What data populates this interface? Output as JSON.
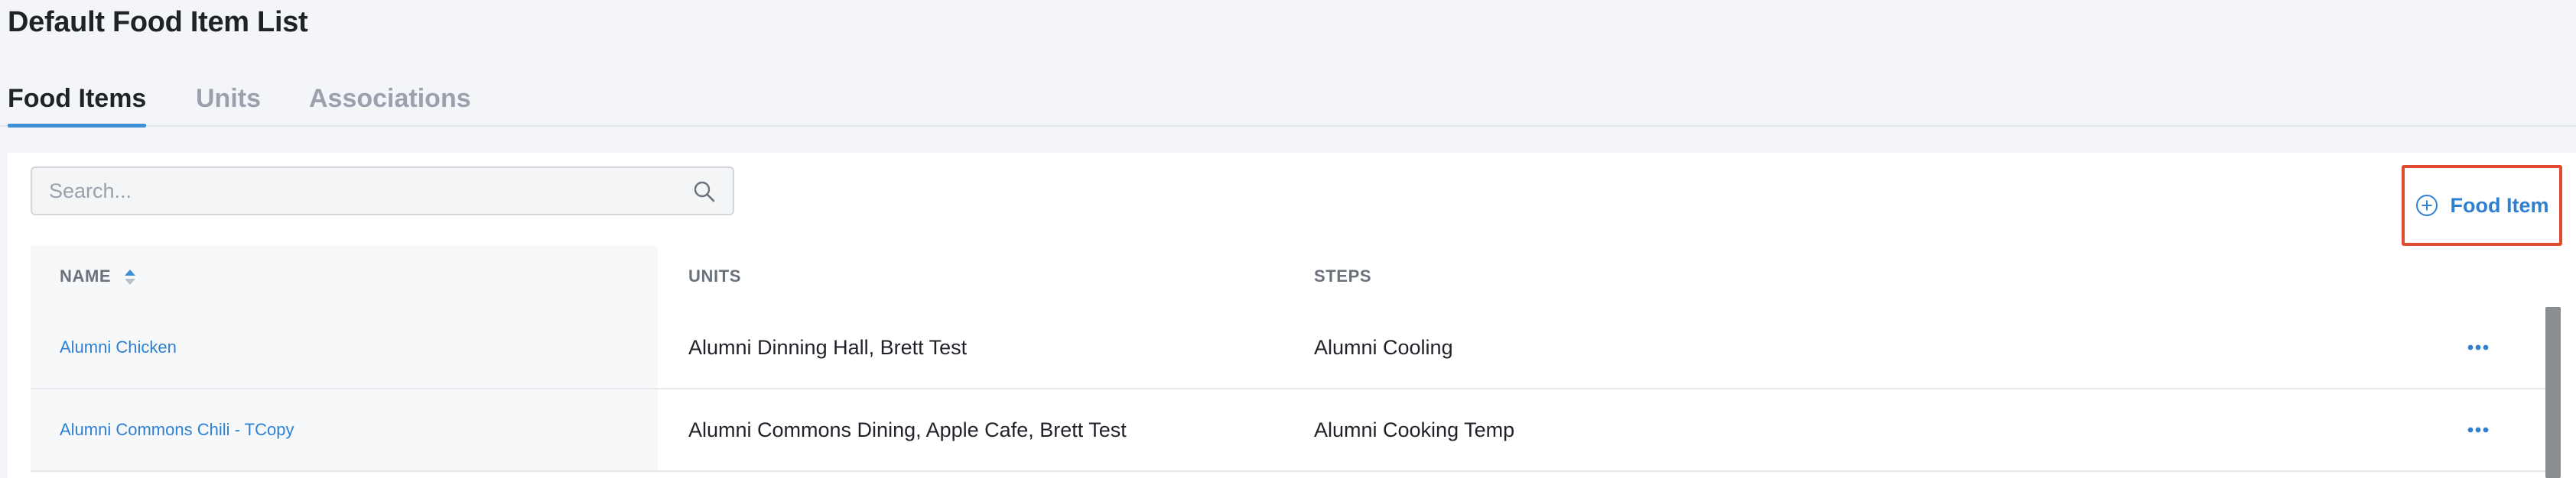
{
  "page": {
    "title": "Default Food Item List"
  },
  "tabs": [
    {
      "label": "Food Items",
      "active": true
    },
    {
      "label": "Units",
      "active": false
    },
    {
      "label": "Associations",
      "active": false
    }
  ],
  "search": {
    "placeholder": "Search...",
    "value": ""
  },
  "toolbar": {
    "add_label": "Food Item"
  },
  "table": {
    "columns": [
      "NAME",
      "UNITS",
      "STEPS"
    ],
    "sort": {
      "column": "NAME",
      "direction": "ascending"
    },
    "rows": [
      {
        "name": "Alumni Chicken",
        "units": "Alumni Dinning Hall, Brett Test",
        "steps": "Alumni Cooling"
      },
      {
        "name": "Alumni Commons Chili - TCopy",
        "units": "Alumni Commons Dining, Apple Cafe, Brett Test",
        "steps": "Alumni Cooking Temp"
      }
    ]
  },
  "colors": {
    "accent": "#2f80d1",
    "tab_underline": "#3d8fd8",
    "highlight_border": "#e04b2f",
    "background": "#f4f5f8"
  },
  "icons": {
    "search": "search-icon",
    "add": "plus-circle-icon",
    "sort": "sort-icon",
    "row_actions": "more-horizontal-icon"
  }
}
